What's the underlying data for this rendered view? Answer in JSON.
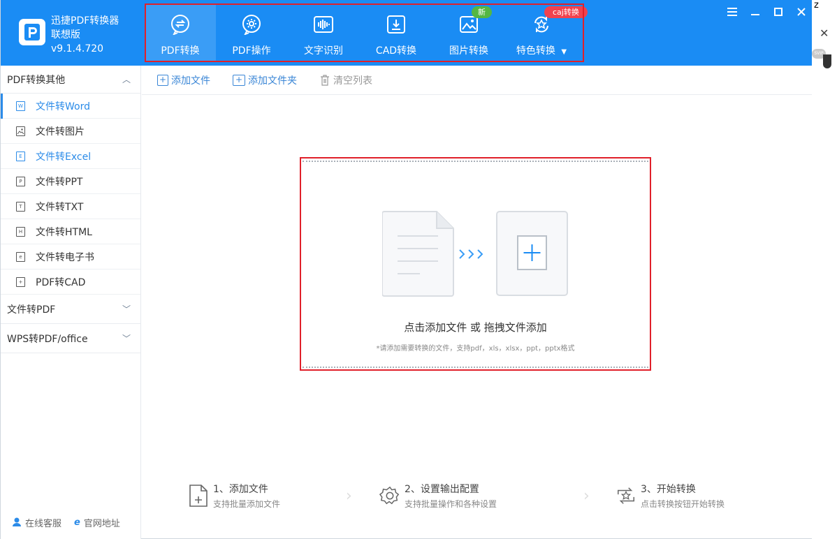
{
  "app": {
    "name": "迅捷PDF转换器",
    "edition": "联想版",
    "version": "v9.1.4.720"
  },
  "nav": [
    {
      "label": "PDF转换",
      "icon": "pdf-convert-icon",
      "active": true
    },
    {
      "label": "PDF操作",
      "icon": "pdf-operation-icon"
    },
    {
      "label": "文字识别",
      "icon": "ocr-wave-icon"
    },
    {
      "label": "CAD转换",
      "icon": "cad-convert-icon"
    },
    {
      "label": "图片转换",
      "icon": "image-convert-icon",
      "badge": "新"
    },
    {
      "label": "特色转换",
      "icon": "special-convert-icon",
      "badge": "caj转换"
    }
  ],
  "sidebar": {
    "group1": "PDF转换其他",
    "items": [
      {
        "label": "文件转Word",
        "icon": "W"
      },
      {
        "label": "文件转图片",
        "icon": "img"
      },
      {
        "label": "文件转Excel",
        "icon": "E"
      },
      {
        "label": "文件转PPT",
        "icon": "P"
      },
      {
        "label": "文件转TXT",
        "icon": "T"
      },
      {
        "label": "文件转HTML",
        "icon": "H"
      },
      {
        "label": "文件转电子书",
        "icon": "e"
      },
      {
        "label": "PDF转CAD",
        "icon": "+"
      }
    ],
    "group2": "文件转PDF",
    "group3": "WPS转PDF/office",
    "footer": {
      "support": "在线客服",
      "website": "官网地址"
    }
  },
  "toolbar": {
    "add_file": "添加文件",
    "add_folder": "添加文件夹",
    "clear_list": "清空列表"
  },
  "dropzone": {
    "title": "点击添加文件 或 拖拽文件添加",
    "hint": "*请添加需要转换的文件，支持pdf，xls，xlsx，ppt，pptx格式"
  },
  "steps": [
    {
      "title": "1、添加文件",
      "sub": "支持批量添加文件"
    },
    {
      "title": "2、设置输出配置",
      "sub": "支持批量操作和各种设置"
    },
    {
      "title": "3、开始转换",
      "sub": "点击转换按钮开始转换"
    }
  ],
  "peek": {
    "svip": "SVIP",
    "close": "✕"
  },
  "colors": {
    "brand": "#1a8cf4",
    "highlight": "#e0202a",
    "accent": "#2b8be8"
  }
}
